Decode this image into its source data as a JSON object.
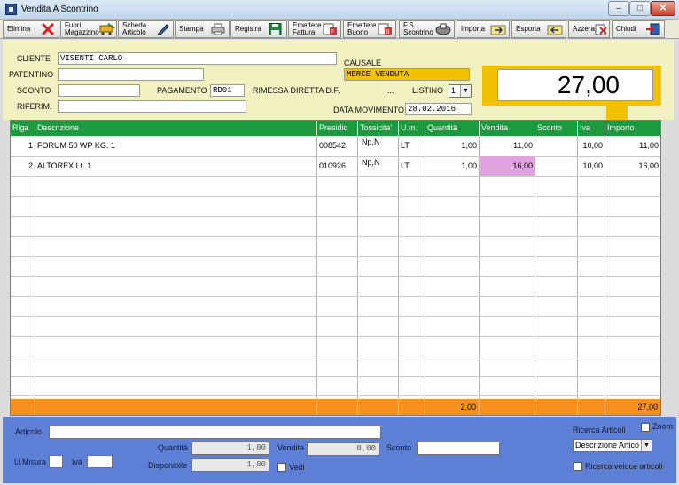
{
  "window": {
    "title": "Vendita A Scontrino",
    "minimize": "–",
    "maximize": "□",
    "close": "✕"
  },
  "toolbar": [
    {
      "label": "Elimina",
      "icon": "delete-x-icon"
    },
    {
      "label": "Fuori\nMagazzino",
      "icon": "cart-icon"
    },
    {
      "label": "Scheda\nArticolo",
      "icon": "edit-icon"
    },
    {
      "label": "Stampa",
      "icon": "printer-icon"
    },
    {
      "label": "Registra",
      "icon": "save-icon"
    },
    {
      "label": "Emettere\nFattura",
      "icon": "invoice-icon"
    },
    {
      "label": "Emettere\nBuono",
      "icon": "voucher-icon"
    },
    {
      "label": "F.S.\nScontrino",
      "icon": "receipt-icon"
    },
    {
      "label": "Importa",
      "icon": "import-icon"
    },
    {
      "label": "Esporta",
      "icon": "export-icon"
    },
    {
      "label": "Azzera",
      "icon": "reset-icon"
    },
    {
      "label": "Chiudi",
      "icon": "exit-icon"
    }
  ],
  "form": {
    "cliente_label": "CLIENTE",
    "cliente_value": "VISENTI CARLO",
    "patentino_label": "PATENTINO",
    "patentino_value": "",
    "sconto_label": "SCONTO",
    "sconto_value": "",
    "pagamento_label": "PAGAMENTO",
    "pagamento_value": "RD01",
    "pagamento_desc": "RIMESSA DIRETTA D.F.",
    "pagamento_more": "...",
    "riferim_label": "RIFERIM.",
    "riferim_value": "",
    "causale_label": "CAUSALE",
    "causale_value": "MERCE VENDUTA",
    "listino_label": "LISTINO",
    "listino_value": "1",
    "data_label": "DATA MOVIMENTO",
    "data_value": "28.02.2016",
    "total": "27,00"
  },
  "grid": {
    "columns": [
      "Riga",
      "Descrizione",
      "Presidio",
      "Tossicita'",
      "U.m.",
      "Quantità",
      "Vendita",
      "Sconto",
      "Iva",
      "Importo"
    ],
    "rows": [
      {
        "riga": "1",
        "descrizione": "FORUM 50 WP KG. 1",
        "presidio": "008542",
        "tossicita": "Np,N",
        "um": "LT",
        "quantita": "1,00",
        "vendita": "11,00",
        "sconto": "",
        "iva": "10,00",
        "importo": "11,00"
      },
      {
        "riga": "2",
        "descrizione": "ALTOREX Lt. 1",
        "presidio": "010926",
        "tossicita": "Np,N",
        "um": "LT",
        "quantita": "1,00",
        "vendita": "16,00",
        "sconto": "",
        "iva": "10,00",
        "importo": "16,00"
      }
    ],
    "footer": {
      "quantita": "2,00",
      "importo": "27,00"
    },
    "highlight_color": "#e0a3e0",
    "header_color": "#1b9a3f",
    "footer_color": "#f7911e"
  },
  "bottom": {
    "articolo_label": "Articolo",
    "articolo_value": "",
    "quantita_label": "Quantità",
    "quantita_value": "1,00",
    "vendita_label": "Vendita",
    "vendita_value": "0,00",
    "sconto_label": "Sconto",
    "sconto_value": "",
    "disponibile_label": "Disponibile",
    "disponibile_value": "1,00",
    "vedi_label": "Vedi",
    "umisura_label": "U.Misura",
    "iva_label": "Iva",
    "ricerca_label": "Ricerca Articoli",
    "ricerca_value": "Descrizione Artico",
    "zoom_label": "Zoom",
    "ricerca_veloce_label": "Ricerca veloce articoli"
  }
}
